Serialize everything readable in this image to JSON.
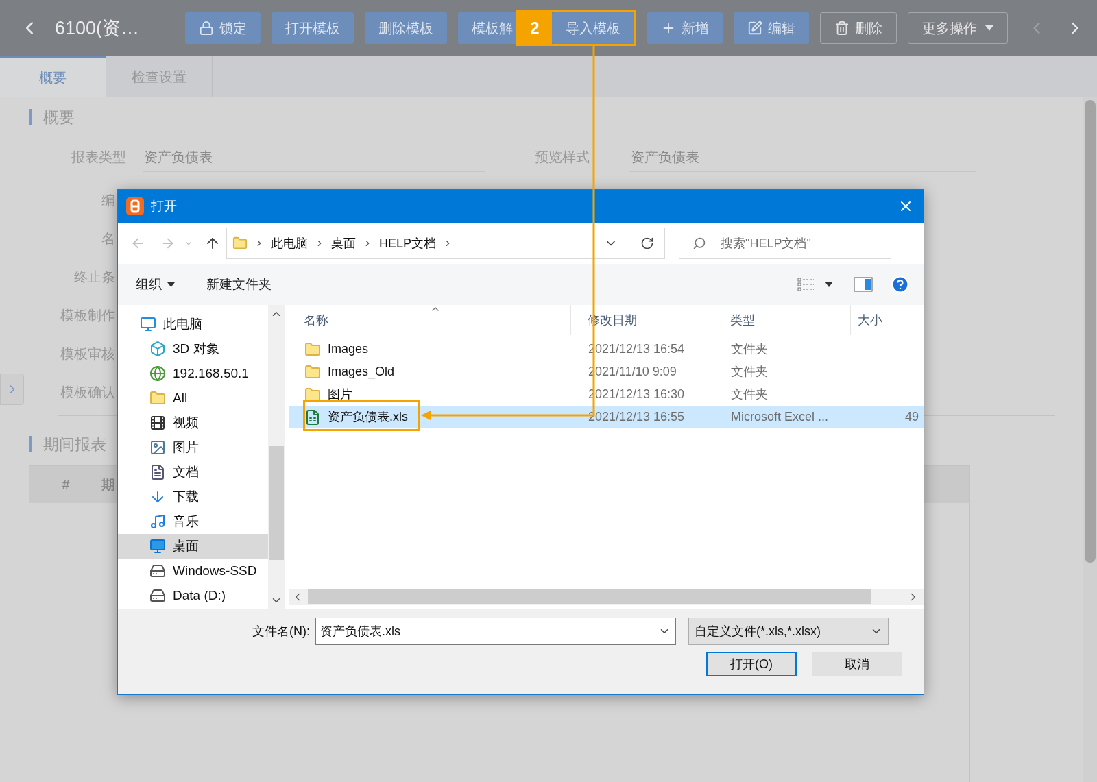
{
  "header": {
    "title": "6100(资…",
    "buttons": [
      {
        "label": "锁定",
        "kind": "lock",
        "highlighted": false
      },
      {
        "label": "打开模板",
        "kind": "plain",
        "highlighted": false
      },
      {
        "label": "删除模板",
        "kind": "plain",
        "highlighted": false
      },
      {
        "label": "模板解",
        "kind": "plain",
        "highlighted": false
      },
      {
        "label": "导入模板",
        "kind": "plain",
        "highlighted": true
      },
      {
        "label": "新增",
        "kind": "plus",
        "highlighted": false
      },
      {
        "label": "编辑",
        "kind": "edit",
        "highlighted": false
      },
      {
        "label": "删除",
        "kind": "trash",
        "highlighted": false
      },
      {
        "label": "更多操作",
        "kind": "more",
        "highlighted": false
      }
    ]
  },
  "tabs": [
    {
      "label": "概要",
      "selected": true
    },
    {
      "label": "检查设置",
      "selected": false
    }
  ],
  "overview": {
    "title": "概要",
    "fields": [
      {
        "label": "报表类型",
        "value": "资产负债表"
      },
      {
        "label": "预览样式",
        "value": "资产负债表"
      }
    ],
    "hidden_labels": [
      "编",
      "名",
      "终止条",
      "模板制作",
      "模板审核",
      "模板确认"
    ]
  },
  "period": {
    "title": "期间报表",
    "columns": [
      "#",
      "期"
    ]
  },
  "dialog": {
    "title": "打开",
    "path": [
      "此电脑",
      "桌面",
      "HELP文档"
    ],
    "search": {
      "placeholder": "搜索\"HELP文档\""
    },
    "toolbar": {
      "organize": "组织",
      "new_folder": "新建文件夹"
    },
    "tree": [
      {
        "label": "此电脑",
        "kind": "pc",
        "selected": false,
        "children": [
          {
            "label": "3D 对象",
            "kind": "cube",
            "selected": false
          },
          {
            "label": "192.168.50.1",
            "kind": "network",
            "selected": false
          },
          {
            "label": "All",
            "kind": "folder",
            "selected": false
          },
          {
            "label": "视频",
            "kind": "video",
            "selected": false
          },
          {
            "label": "图片",
            "kind": "pictures",
            "selected": false
          },
          {
            "label": "文档",
            "kind": "documents",
            "selected": false
          },
          {
            "label": "下载",
            "kind": "downloads",
            "selected": false
          },
          {
            "label": "音乐",
            "kind": "music",
            "selected": false
          },
          {
            "label": "桌面",
            "kind": "desktop",
            "selected": true
          },
          {
            "label": "Windows-SSD",
            "kind": "drive",
            "selected": false
          },
          {
            "label": "Data (D:)",
            "kind": "drive",
            "selected": false
          }
        ]
      }
    ],
    "columns": [
      "名称",
      "修改日期",
      "类型",
      "大小"
    ],
    "files": [
      {
        "name": "Images",
        "kind": "folder",
        "date": "2021/12/13 16:54",
        "type": "文件夹",
        "selected": false
      },
      {
        "name": "Images_Old",
        "kind": "folder",
        "date": "2021/11/10 9:09",
        "type": "文件夹",
        "selected": false
      },
      {
        "name": "图片",
        "kind": "folder",
        "date": "2021/12/13 16:30",
        "type": "文件夹",
        "selected": false
      },
      {
        "name": "资产负债表.xls",
        "kind": "excel",
        "date": "2021/12/13 16:55",
        "type": "Microsoft Excel ...",
        "size": "49",
        "selected": true
      }
    ],
    "filename_label": "文件名(N):",
    "filename": "资产负债表.xls",
    "filter": "自定义文件(*.xls,*.xlsx)",
    "buttons": [
      {
        "label": "打开(O)",
        "default": true
      },
      {
        "label": "取消",
        "default": false
      }
    ]
  },
  "annotation": {
    "step": "2"
  }
}
